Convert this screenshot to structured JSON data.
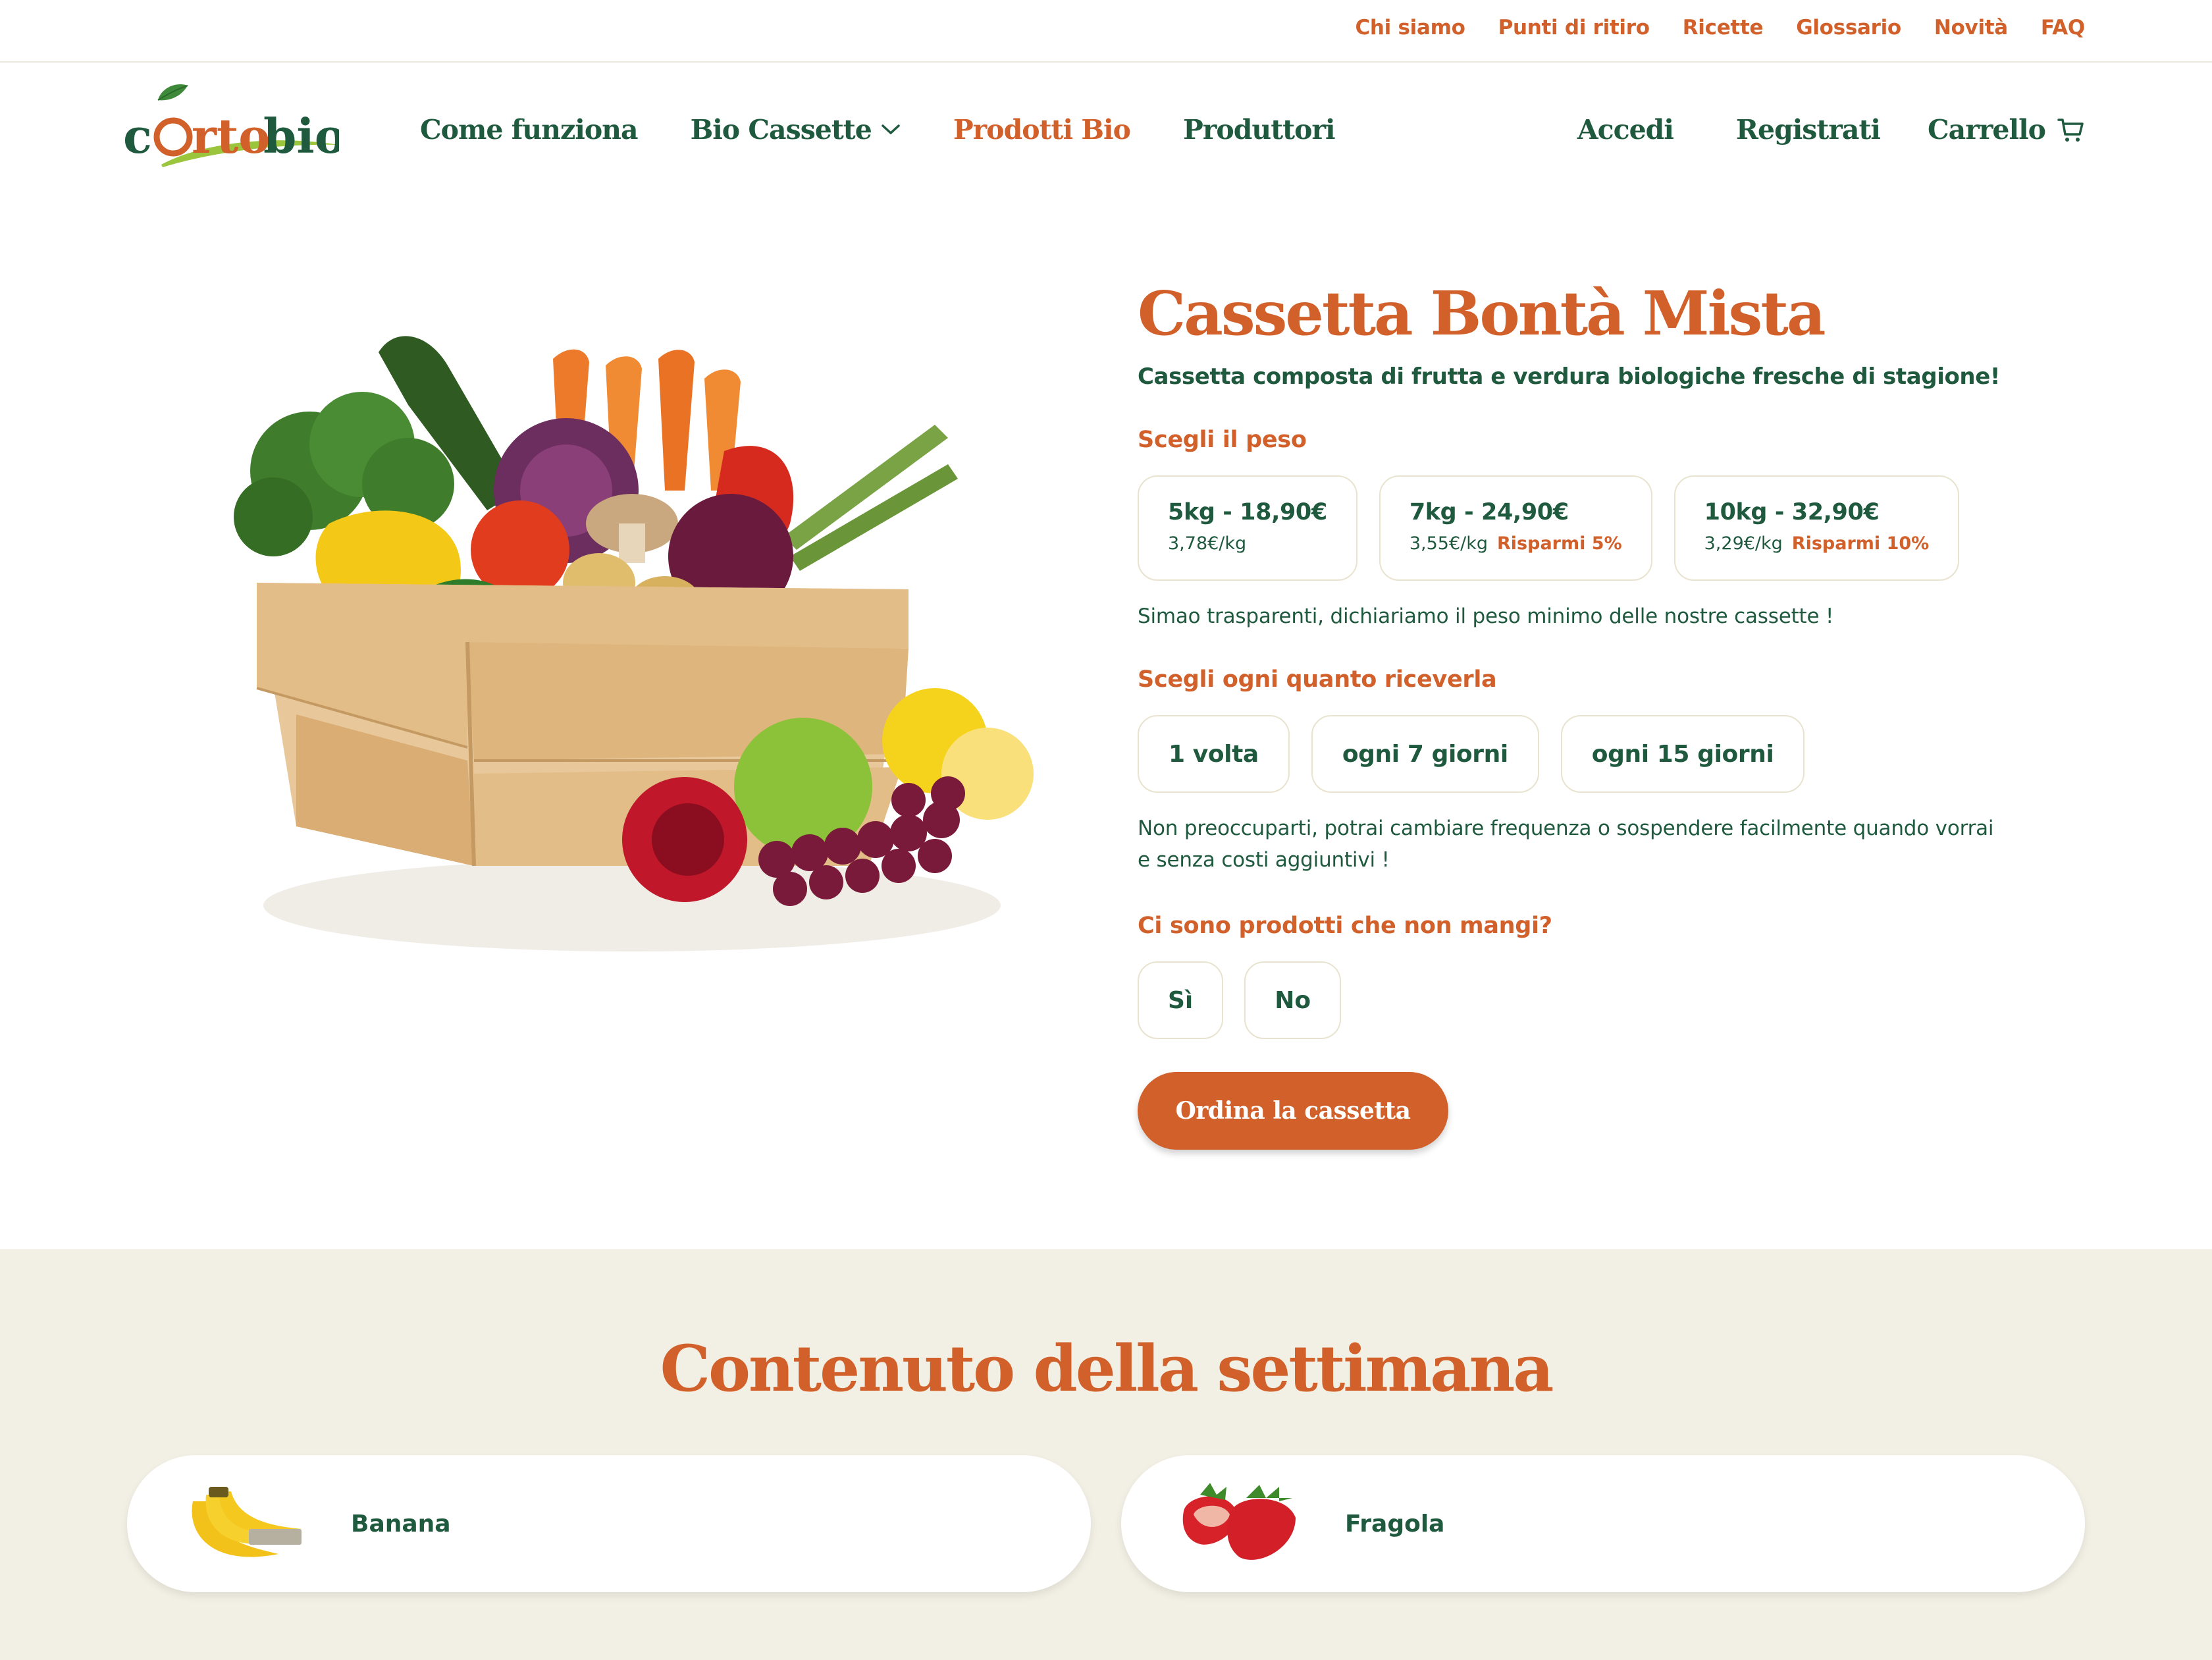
{
  "topbar": {
    "links": [
      "Chi siamo",
      "Punti di ritiro",
      "Ricette",
      "Glossario",
      "Novità",
      "FAQ"
    ]
  },
  "logo": {
    "text_pre": "c",
    "text_mid": "rto",
    "text_post": "bio"
  },
  "nav": {
    "come_funziona": "Come funziona",
    "bio_cassette": "Bio Cassette",
    "prodotti_bio": "Prodotti Bio",
    "produttori": "Produttori",
    "accedi": "Accedi",
    "registrati": "Registrati",
    "carrello": "Carrello"
  },
  "product": {
    "title": "Cassetta Bontà Mista",
    "subtitle": "Cassetta composta di frutta e verdura biologiche fresche di stagione!",
    "weight_label": "Scegli il peso",
    "weights": [
      {
        "main": "5kg - 18,90€",
        "per_kg": "3,78€/kg",
        "save": ""
      },
      {
        "main": "7kg - 24,90€",
        "per_kg": "3,55€/kg",
        "save": "Risparmi 5%"
      },
      {
        "main": "10kg - 32,90€",
        "per_kg": "3,29€/kg",
        "save": "Risparmi 10%"
      }
    ],
    "weight_note": "Simao trasparenti, dichiariamo il peso minimo delle nostre cassette !",
    "freq_label": "Scegli ogni quanto riceverla",
    "frequencies": [
      "1 volta",
      "ogni 7 giorni",
      "ogni 15 giorni"
    ],
    "freq_note_1": "Non preoccuparti, potrai cambiare frequenza o sospendere facilmente quando vorrai",
    "freq_note_2": "e senza costi aggiuntivi !",
    "exclude_label": "Ci sono prodotti che non mangi?",
    "yes": "Sì",
    "no": "No",
    "order_button": "Ordina la cassetta"
  },
  "weekly": {
    "title": "Contenuto della settimana",
    "items": [
      {
        "name": "Banana",
        "icon": "banana-image"
      },
      {
        "name": "Fragola",
        "icon": "strawberry-image"
      }
    ]
  },
  "colors": {
    "accent": "#d1602a",
    "primary_text": "#1f5a3f",
    "section_bg": "#f2efe4",
    "border": "#e8e3cf"
  }
}
